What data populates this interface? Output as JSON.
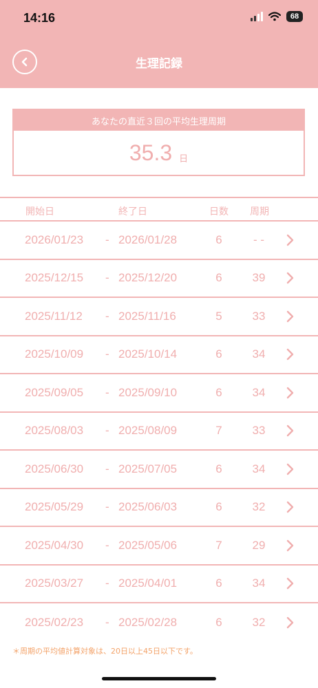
{
  "status_bar": {
    "time": "14:16",
    "battery": "68"
  },
  "nav": {
    "title": "生理記録"
  },
  "summary": {
    "heading": "あなたの直近３回の平均生理周期",
    "average": "35.3",
    "unit": "日"
  },
  "table": {
    "headers": {
      "start": "開始日",
      "end": "終了日",
      "days": "日数",
      "cycle": "周期"
    },
    "separator": "-",
    "rows": [
      {
        "start": "2026/01/23",
        "end": "2026/01/28",
        "days": "6",
        "cycle": "- -"
      },
      {
        "start": "2025/12/15",
        "end": "2025/12/20",
        "days": "6",
        "cycle": "39"
      },
      {
        "start": "2025/11/12",
        "end": "2025/11/16",
        "days": "5",
        "cycle": "33"
      },
      {
        "start": "2025/10/09",
        "end": "2025/10/14",
        "days": "6",
        "cycle": "34"
      },
      {
        "start": "2025/09/05",
        "end": "2025/09/10",
        "days": "6",
        "cycle": "34"
      },
      {
        "start": "2025/08/03",
        "end": "2025/08/09",
        "days": "7",
        "cycle": "33"
      },
      {
        "start": "2025/06/30",
        "end": "2025/07/05",
        "days": "6",
        "cycle": "34"
      },
      {
        "start": "2025/05/29",
        "end": "2025/06/03",
        "days": "6",
        "cycle": "32"
      },
      {
        "start": "2025/04/30",
        "end": "2025/05/06",
        "days": "7",
        "cycle": "29"
      },
      {
        "start": "2025/03/27",
        "end": "2025/04/01",
        "days": "6",
        "cycle": "34"
      },
      {
        "start": "2025/02/23",
        "end": "2025/02/28",
        "days": "6",
        "cycle": "32"
      }
    ]
  },
  "footnote": "＊周期の平均値計算対象は、20日以上45日以下です。",
  "colors": {
    "accent": "#f2b5b5",
    "text": "#f0aeae",
    "note": "#f3a36a"
  }
}
